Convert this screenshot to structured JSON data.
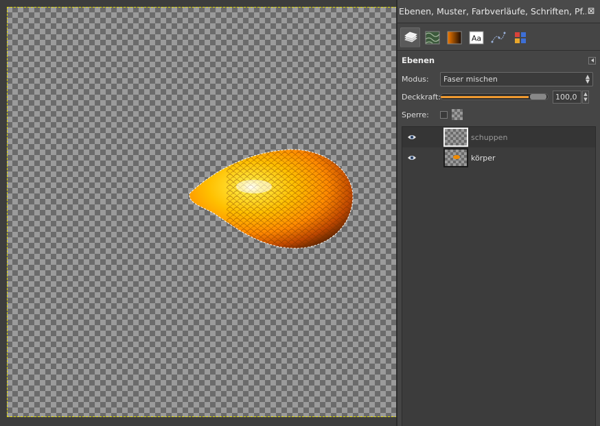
{
  "dock": {
    "title": "Ebenen, Muster, Farbverläufe, Schriften, Pf...",
    "tabs": [
      {
        "name": "layers-tab",
        "icon": "layers-icon"
      },
      {
        "name": "patterns-tab",
        "icon": "pattern-icon"
      },
      {
        "name": "gradients-tab",
        "icon": "gradient-icon"
      },
      {
        "name": "fonts-tab",
        "icon": "font-icon",
        "label": "Aa"
      },
      {
        "name": "paths-tab",
        "icon": "paths-icon"
      },
      {
        "name": "colormap-tab",
        "icon": "colormap-icon"
      }
    ]
  },
  "layers_panel": {
    "title": "Ebenen",
    "mode_label": "Modus:",
    "mode_value": "Faser mischen",
    "opacity_label": "Deckkraft:",
    "opacity_value": "100,0",
    "opacity_fraction": 1.0,
    "lock_label": "Sperre:",
    "layers": [
      {
        "name": "schuppen",
        "visible": true,
        "selected": true
      },
      {
        "name": "körper",
        "visible": true,
        "selected": false
      }
    ]
  },
  "colors": {
    "accent": "#f09a30",
    "selection_border": "#e7e000"
  }
}
